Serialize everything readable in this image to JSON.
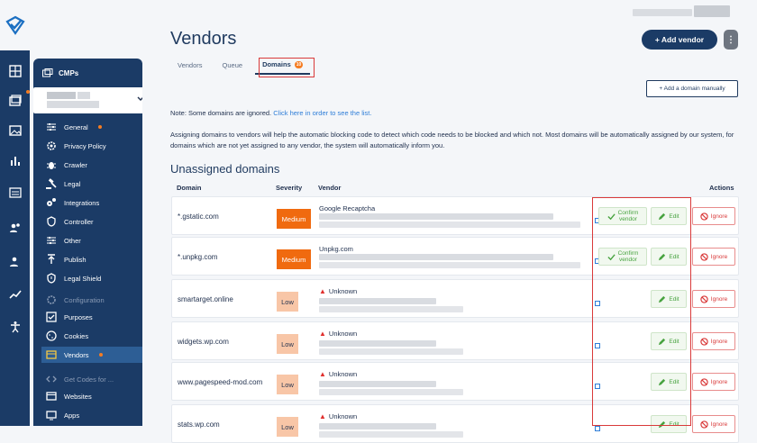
{
  "page": {
    "title": "Vendors"
  },
  "tabs": [
    {
      "label": "Vendors"
    },
    {
      "label": "Queue"
    },
    {
      "label": "Domains",
      "count": "10"
    }
  ],
  "buttons": {
    "add_vendor": "+ Add vendor",
    "more": "⋮",
    "add_domain": "+ Add a domain manually"
  },
  "note": {
    "text": "Note: Some domains are ignored.",
    "link": "Click here in order to see the list."
  },
  "description": "Assigning domains to vendors will help the automatic blocking code to detect which code needs to be blocked and which not. Most domains will be automatically assigned by our system, for domains which are not yet assigned to any vendor, the system will automatically inform you.",
  "section_title": "Unassigned domains",
  "table": {
    "headers": {
      "domain": "Domain",
      "severity": "Severity",
      "vendor": "Vendor",
      "actions": "Actions"
    },
    "rows": [
      {
        "domain": "*.gstatic.com",
        "severity": "Medium",
        "vendor": "Google Recaptcha",
        "unknown": false,
        "confirm": true
      },
      {
        "domain": "*.unpkg.com",
        "severity": "Medium",
        "vendor": "Unpkg.com",
        "unknown": false,
        "confirm": true
      },
      {
        "domain": "smartarget.online",
        "severity": "Low",
        "vendor": "Unknown",
        "unknown": true,
        "confirm": false
      },
      {
        "domain": "widgets.wp.com",
        "severity": "Low",
        "vendor": "Unknown",
        "unknown": true,
        "confirm": false
      },
      {
        "domain": "www.pagespeed-mod.com",
        "severity": "Low",
        "vendor": "Unknown",
        "unknown": true,
        "confirm": false
      },
      {
        "domain": "stats.wp.com",
        "severity": "Low",
        "vendor": "Unknown",
        "unknown": true,
        "confirm": false
      }
    ],
    "actions": {
      "confirm_1": "Confirm",
      "confirm_2": "vendor",
      "edit": "Edit",
      "ignore": "Ignore"
    }
  },
  "sidebar": {
    "heading": "CMPs",
    "items": [
      {
        "label": "General",
        "icon": "sliders-icon",
        "dot": true
      },
      {
        "label": "Privacy Policy",
        "icon": "settings-icon"
      },
      {
        "label": "Crawler",
        "icon": "bug-icon"
      },
      {
        "label": "Legal",
        "icon": "gavel-icon"
      },
      {
        "label": "Integrations",
        "icon": "gears-icon"
      },
      {
        "label": "Controller",
        "icon": "shield-icon"
      },
      {
        "label": "Other",
        "icon": "sliders-icon"
      },
      {
        "label": "Publish",
        "icon": "publish-icon"
      },
      {
        "label": "Legal Shield",
        "icon": "shield-icon"
      },
      {
        "label": "Configuration",
        "icon": "settings-icon",
        "dim": true
      },
      {
        "label": "Purposes",
        "icon": "check-square-icon"
      },
      {
        "label": "Cookies",
        "icon": "cookie-icon"
      },
      {
        "label": "Vendors",
        "icon": "vendor-icon",
        "dot": true,
        "active": true
      },
      {
        "label": "Get Codes for ...",
        "icon": "code-icon",
        "dim": true
      },
      {
        "label": "Websites",
        "icon": "window-icon"
      },
      {
        "label": "Apps",
        "icon": "apps-icon"
      }
    ]
  },
  "colors": {
    "navy": "#1b3b66",
    "accent": "#f57c22",
    "medium": "#f06a0f",
    "low": "#f8c6a7",
    "green": "#48a340",
    "red": "#d93a3a"
  }
}
